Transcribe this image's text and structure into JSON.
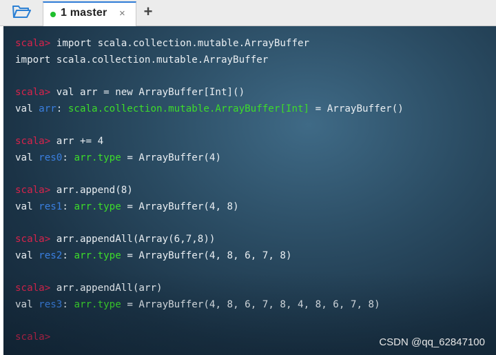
{
  "tabbar": {
    "folder_icon": "folder-open-icon",
    "tab_label": "1 master",
    "tab_status_color": "#1fbf2e",
    "close_glyph": "×",
    "add_glyph": "+"
  },
  "terminal": {
    "prompt": "scala>",
    "lines": [
      {
        "kind": "input",
        "text": " import scala.collection.mutable.ArrayBuffer"
      },
      {
        "kind": "output",
        "text": "import scala.collection.mutable.ArrayBuffer"
      },
      {
        "kind": "blank"
      },
      {
        "kind": "input",
        "text": " val arr = new ArrayBuffer[Int]()"
      },
      {
        "kind": "result",
        "val": "val ",
        "name": "arr",
        "sep": ": ",
        "type": "scala.collection.mutable.ArrayBuffer[Int]",
        "rest": " = ArrayBuffer()"
      },
      {
        "kind": "blank"
      },
      {
        "kind": "input",
        "text": " arr += 4"
      },
      {
        "kind": "result",
        "val": "val ",
        "name": "res0",
        "sep": ": ",
        "type": "arr.type",
        "rest": " = ArrayBuffer(4)"
      },
      {
        "kind": "blank"
      },
      {
        "kind": "input",
        "text": " arr.append(8)"
      },
      {
        "kind": "result",
        "val": "val ",
        "name": "res1",
        "sep": ": ",
        "type": "arr.type",
        "rest": " = ArrayBuffer(4, 8)"
      },
      {
        "kind": "blank"
      },
      {
        "kind": "input",
        "text": " arr.appendAll(Array(6,7,8))"
      },
      {
        "kind": "result",
        "val": "val ",
        "name": "res2",
        "sep": ": ",
        "type": "arr.type",
        "rest": " = ArrayBuffer(4, 8, 6, 7, 8)"
      },
      {
        "kind": "blank"
      },
      {
        "kind": "input",
        "text": " arr.appendAll(arr)"
      },
      {
        "kind": "result",
        "val": "val ",
        "name": "res3",
        "sep": ": ",
        "type": "arr.type",
        "rest": " = ArrayBuffer(4, 8, 6, 7, 8, 4, 8, 6, 7, 8)"
      },
      {
        "kind": "blank"
      },
      {
        "kind": "input",
        "text": ""
      }
    ]
  },
  "watermark": "CSDN @qq_62847100"
}
